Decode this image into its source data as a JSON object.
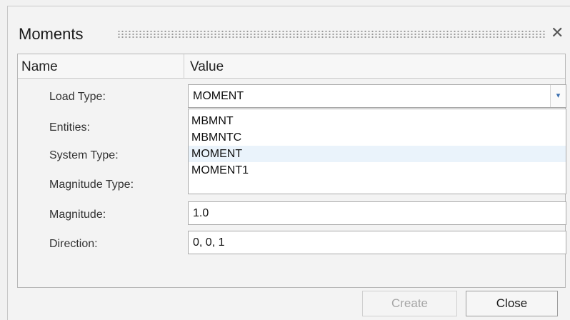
{
  "dialog": {
    "title": "Moments",
    "close_glyph": "✕"
  },
  "grid": {
    "headers": {
      "name": "Name",
      "value": "Value"
    },
    "rows": [
      {
        "label": "Load Type:"
      },
      {
        "label": "Entities:"
      },
      {
        "label": "System Type:"
      },
      {
        "label": "Magnitude Type:"
      },
      {
        "label": "Magnitude:",
        "value": "1.0"
      },
      {
        "label": "Direction:",
        "value": "0, 0, 1"
      }
    ],
    "load_type": {
      "selected": "MOMENT",
      "arrow_glyph": "▾",
      "options": [
        "MBMNT",
        "MBMNTC",
        "MOMENT",
        "MOMENT1"
      ]
    }
  },
  "buttons": {
    "create": "Create",
    "close": "Close"
  },
  "colors": {
    "selected_option_bg": "#eaf3fb",
    "disabled_text": "#a6a6a6",
    "arrow": "#3a6fb0"
  }
}
